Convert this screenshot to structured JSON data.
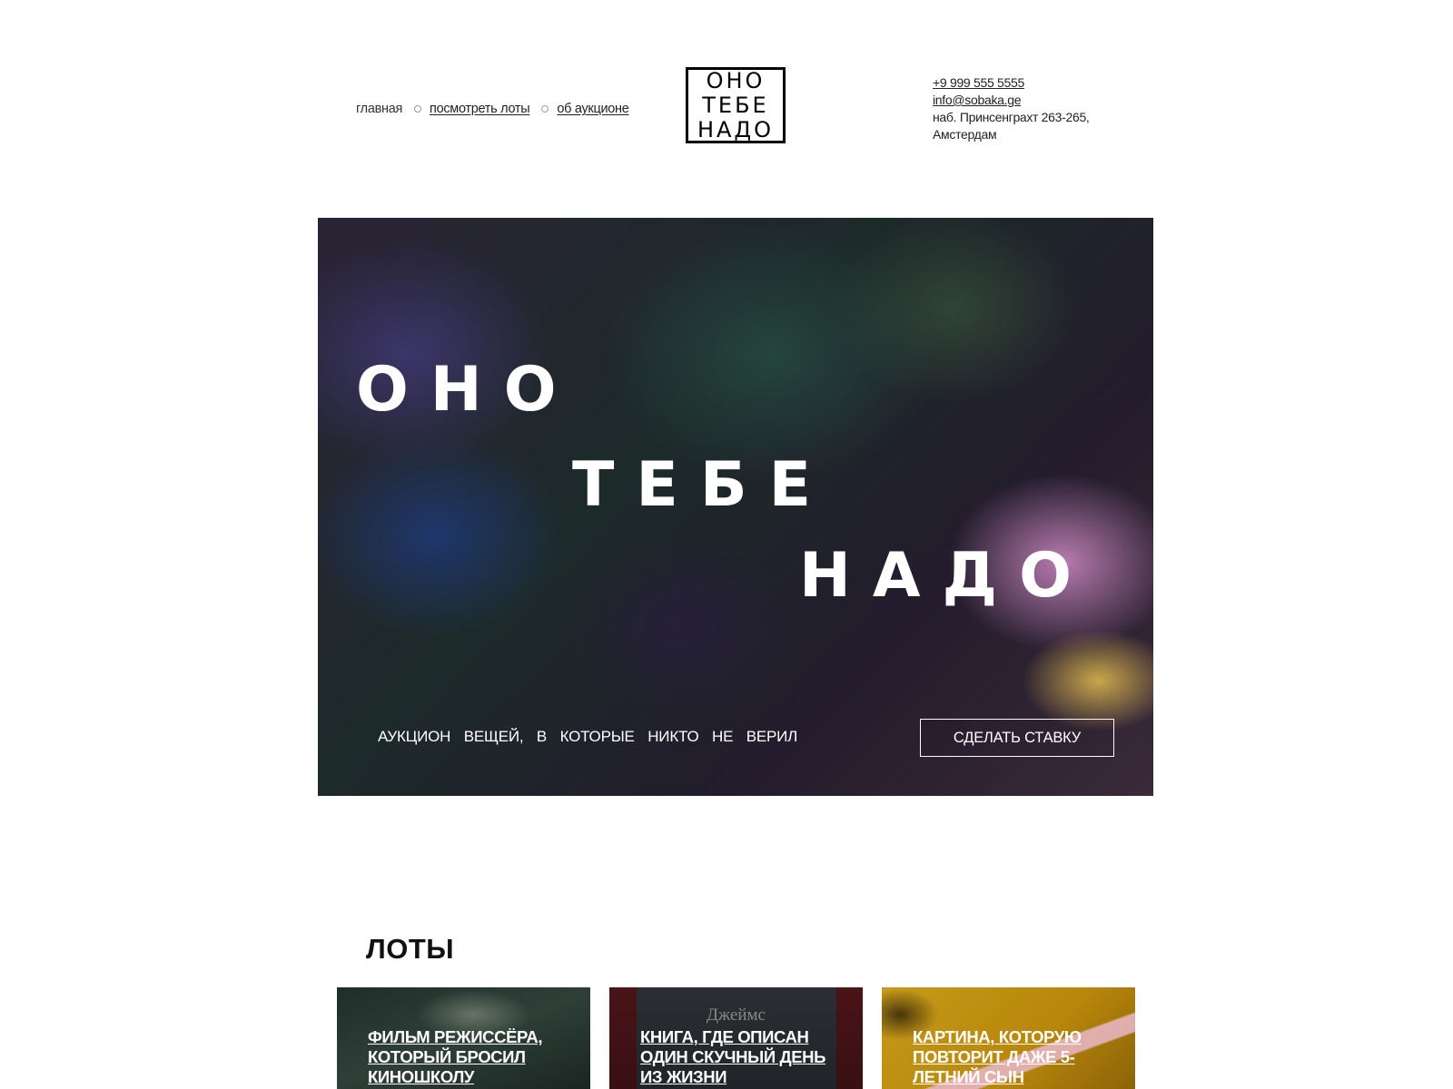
{
  "nav": {
    "items": [
      {
        "label": "главная"
      },
      {
        "label": "посмотреть лоты"
      },
      {
        "label": "об аукционе"
      }
    ]
  },
  "logo": {
    "lines": [
      "ОНО",
      "ТЕБЕ",
      "НАДО"
    ]
  },
  "contacts": {
    "phone": "+9 999 555 5555",
    "email": "info@sobaka.ge",
    "address": "наб. Принсенграхт 263-265, Амстердам"
  },
  "hero": {
    "lines": [
      "ОНО",
      "ТЕБЕ",
      "НАДО"
    ],
    "tagline": "АУКЦИОН ВЕЩЕЙ, В КОТОРЫЕ НИКТО НЕ ВЕРИЛ",
    "cta_label": "СДЕЛАТЬ СТАВКУ"
  },
  "lots": {
    "title": "ЛОТЫ",
    "items": [
      {
        "title": "ФИЛЬМ РЕЖИССЁРА, КОТОРЫЙ БРОСИЛ КИНОШКОЛУ"
      },
      {
        "title": "КНИГА, ГДЕ ОПИСАН ОДИН СКУЧНЫЙ ДЕНЬ ИЗ ЖИЗНИ",
        "image_text": "Джеймс"
      },
      {
        "title": "КАРТИНА, КОТОРУЮ ПОВТОРИТ ДАЖЕ 5-ЛЕТНИЙ СЫН"
      }
    ]
  }
}
